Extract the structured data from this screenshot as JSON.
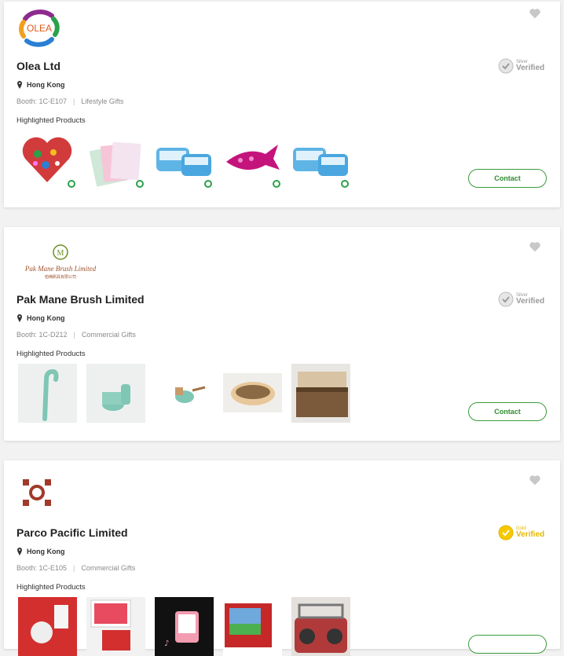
{
  "companies": [
    {
      "name": "Olea Ltd",
      "location": "Hong Kong",
      "booth": "Booth: 1C-E107",
      "category": "Lifestyle Gifts",
      "highlighted_label": "Highlighted Products",
      "verified_tier": "Silver",
      "verified_word": "Verified",
      "contact_label": "Contact",
      "logo_text": "OLEA"
    },
    {
      "name": "Pak Mane Brush Limited",
      "location": "Hong Kong",
      "booth": "Booth: 1C-D212",
      "category": "Commercial Gifts",
      "highlighted_label": "Highlighted Products",
      "verified_tier": "Silver",
      "verified_word": "Verified",
      "contact_label": "Contact",
      "logo_text": "Pak Mane Brush Limited",
      "logo_subtext": "柏楠刷具有限公司"
    },
    {
      "name": "Parco Pacific Limited",
      "location": "Hong Kong",
      "booth": "Booth: 1C-E105",
      "category": "Commercial Gifts",
      "highlighted_label": "Highlighted Products",
      "verified_tier": "Gold",
      "verified_word": "Verified"
    }
  ],
  "colors": {
    "accent_green": "#2e8b2e",
    "silver": "#9a9a9a",
    "gold": "#e3b800",
    "heart": "#c8c8c8"
  },
  "icons": [
    "heart-icon",
    "location-pin-icon",
    "verified-seal-icon"
  ]
}
